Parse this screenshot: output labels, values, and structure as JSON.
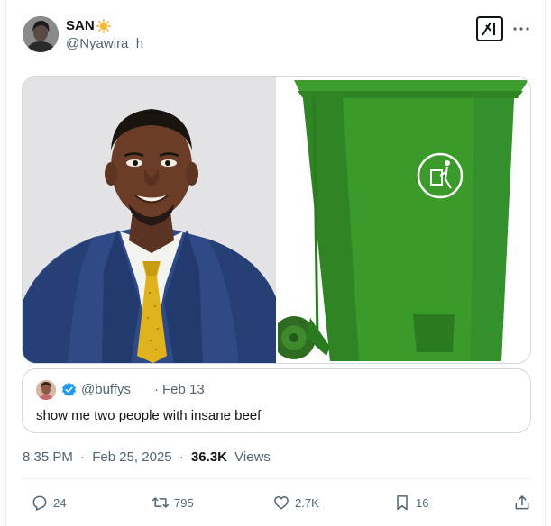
{
  "author": {
    "display_name": "SAN",
    "handle": "@Nyawira_h",
    "emoji_icon": "sun-emoji"
  },
  "header_icons": [
    "grok-icon",
    "more-icon"
  ],
  "media": {
    "left_image": "photo of smiling man in navy suit and yellow tie",
    "right_image": "photo of green wheelie trash bin"
  },
  "quoted_post": {
    "handle": "@buffys",
    "separator": "·",
    "date": "Feb 13",
    "text": "show me two people with insane beef",
    "verified": true
  },
  "meta": {
    "time": "8:35 PM",
    "separator": "·",
    "date": "Feb 25, 2025",
    "views_count": "36.3K",
    "views_label": "Views"
  },
  "actions": {
    "replies": "24",
    "reposts": "795",
    "likes": "2.7K",
    "bookmarks": "16"
  },
  "colors": {
    "text_primary": "#0f1419",
    "text_secondary": "#536471",
    "border": "#cfd9de",
    "verified_blue": "#1d9bf0",
    "bin_green": "#3a9a2a"
  }
}
